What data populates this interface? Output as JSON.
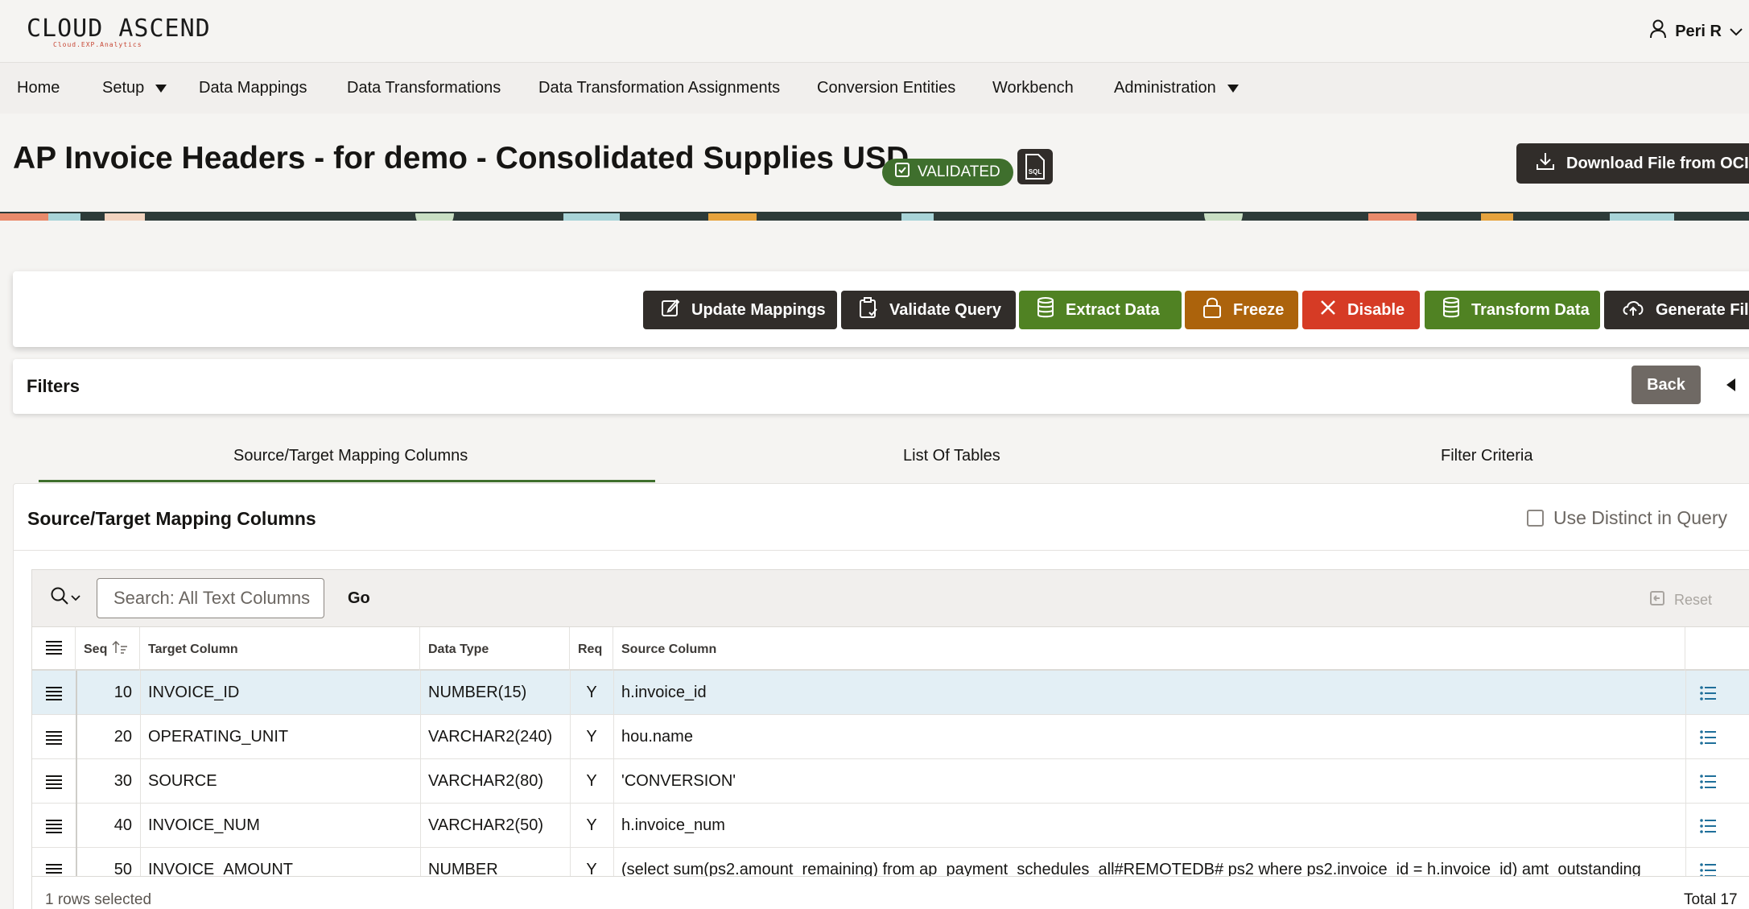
{
  "brand": {
    "name": "CLOUD ASCEND",
    "tagline": "Cloud.EXP.Analytics"
  },
  "user": {
    "name": "Peri R"
  },
  "nav": {
    "home": "Home",
    "setup": "Setup",
    "data_mappings": "Data Mappings",
    "data_transformations": "Data Transformations",
    "data_transformation_assignments": "Data Transformation Assignments",
    "conversion_entities": "Conversion Entities",
    "workbench": "Workbench",
    "administration": "Administration"
  },
  "header": {
    "title": "AP Invoice Headers - for demo - Consolidated Supplies USD",
    "status": "VALIDATED",
    "sql_label": "SQL",
    "download_label": "Download File from OCI"
  },
  "actions": {
    "update_mappings": "Update Mappings",
    "validate_query": "Validate Query",
    "extract_data": "Extract Data",
    "freeze": "Freeze",
    "disable": "Disable",
    "transform_data": "Transform Data",
    "generate_file": "Generate File"
  },
  "colors": {
    "green": "#508223",
    "orange": "#ac630c",
    "red": "#d63b25",
    "dark": "#312d2a"
  },
  "filters": {
    "title": "Filters",
    "back_label": "Back"
  },
  "tabs": [
    "Source/Target Mapping Columns",
    "List Of Tables",
    "Filter Criteria"
  ],
  "region": {
    "title": "Source/Target Mapping Columns",
    "distinct_label": "Use Distinct in Query",
    "distinct_checked": false
  },
  "report": {
    "search_placeholder": "Search: All Text Columns",
    "go_label": "Go",
    "reset_label": "Reset",
    "columns": [
      "Seq",
      "Target Column",
      "Data Type",
      "Req",
      "Source Column"
    ],
    "sort": {
      "column": "Seq",
      "direction": "ascending"
    },
    "rows": [
      {
        "seq": "10",
        "target": "INVOICE_ID",
        "type": "NUMBER(15)",
        "req": "Y",
        "source": "h.invoice_id",
        "selected": true
      },
      {
        "seq": "20",
        "target": "OPERATING_UNIT",
        "type": "VARCHAR2(240)",
        "req": "Y",
        "source": "hou.name",
        "selected": false
      },
      {
        "seq": "30",
        "target": "SOURCE",
        "type": "VARCHAR2(80)",
        "req": "Y",
        "source": "'CONVERSION'",
        "selected": false
      },
      {
        "seq": "40",
        "target": "INVOICE_NUM",
        "type": "VARCHAR2(50)",
        "req": "Y",
        "source": "h.invoice_num",
        "selected": false
      },
      {
        "seq": "50",
        "target": "INVOICE_AMOUNT",
        "type": "NUMBER",
        "req": "Y",
        "source": "(select sum(ps2.amount_remaining) from ap_payment_schedules_all#REMOTEDB# ps2 where ps2.invoice_id = h.invoice_id) amt_outstanding",
        "selected": false
      }
    ],
    "selection_text": "1 rows selected",
    "total_text": "Total 17"
  }
}
